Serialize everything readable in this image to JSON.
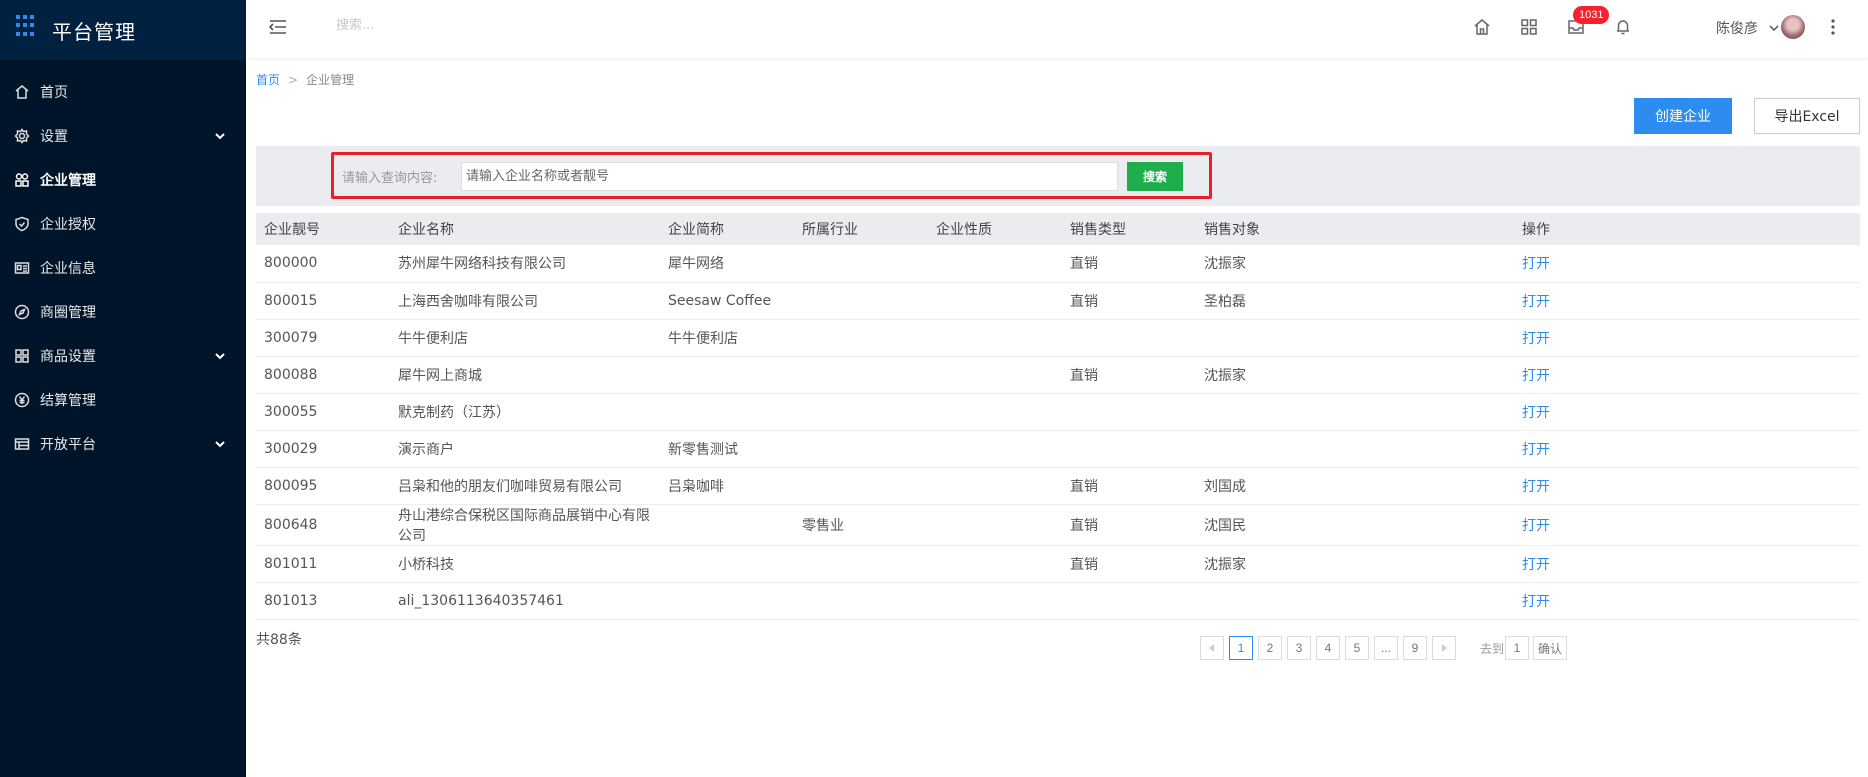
{
  "app": {
    "title": "平台管理"
  },
  "sidebar": {
    "items": [
      {
        "label": "首页",
        "icon": "home-icon",
        "has_children": false
      },
      {
        "label": "设置",
        "icon": "gear-icon",
        "has_children": true
      },
      {
        "label": "企业管理",
        "icon": "enterprise-icon",
        "has_children": false,
        "active": true
      },
      {
        "label": "企业授权",
        "icon": "shield-icon",
        "has_children": false
      },
      {
        "label": "企业信息",
        "icon": "id-card-icon",
        "has_children": false
      },
      {
        "label": "商圈管理",
        "icon": "compass-icon",
        "has_children": false
      },
      {
        "label": "商品设置",
        "icon": "grid-icon",
        "has_children": true
      },
      {
        "label": "结算管理",
        "icon": "yen-icon",
        "has_children": false
      },
      {
        "label": "开放平台",
        "icon": "table-icon",
        "has_children": true
      }
    ]
  },
  "topbar": {
    "search_placeholder": "搜索...",
    "notification_count": "1031",
    "username": "陈俊彦"
  },
  "breadcrumb": {
    "home": "首页",
    "separator": ">",
    "current": "企业管理"
  },
  "actions": {
    "create_label": "创建企业",
    "export_label": "导出Excel"
  },
  "filter": {
    "label": "请输入查询内容:",
    "placeholder": "请输入企业名称或者靓号",
    "search_label": "搜索"
  },
  "table": {
    "columns": [
      "企业靓号",
      "企业名称",
      "企业简称",
      "所属行业",
      "企业性质",
      "销售类型",
      "销售对象",
      "操作"
    ],
    "rows": [
      [
        "800000",
        "苏州犀牛网络科技有限公司",
        "犀牛网络",
        "",
        "",
        "直销",
        "沈振家",
        "打开"
      ],
      [
        "800015",
        "上海西舍咖啡有限公司",
        "Seesaw Coffee",
        "",
        "",
        "直销",
        "圣柏磊",
        "打开"
      ],
      [
        "300079",
        "牛牛便利店",
        "牛牛便利店",
        "",
        "",
        "",
        "",
        "打开"
      ],
      [
        "800088",
        "犀牛网上商城",
        "",
        "",
        "",
        "直销",
        "沈振家",
        "打开"
      ],
      [
        "300055",
        "默克制药（江苏）",
        "",
        "",
        "",
        "",
        "",
        "打开"
      ],
      [
        "300029",
        "演示商户",
        "新零售测试",
        "",
        "",
        "",
        "",
        "打开"
      ],
      [
        "800095",
        "吕枭和他的朋友们咖啡贸易有限公司",
        "吕枭咖啡",
        "",
        "",
        "直销",
        "刘国成",
        "打开"
      ],
      [
        "800648",
        "舟山港综合保税区国际商品展销中心有限公司",
        "",
        "零售业",
        "",
        "直销",
        "沈国民",
        "打开"
      ],
      [
        "801011",
        "小桥科技",
        "",
        "",
        "",
        "直销",
        "沈振家",
        "打开"
      ],
      [
        "801013",
        "ali_1306113640357461",
        "",
        "",
        "",
        "",
        "",
        "打开"
      ]
    ]
  },
  "footer": {
    "total": "共88条",
    "pages": [
      "1",
      "2",
      "3",
      "4",
      "5",
      "...",
      "9"
    ],
    "current_page": "1",
    "goto_label": "去到",
    "goto_value": "1",
    "confirm_label": "确认"
  },
  "colors": {
    "sidebar_bg": "#001529",
    "primary": "#2d8cf0",
    "success": "#1fae4b",
    "danger": "#e8202a"
  }
}
